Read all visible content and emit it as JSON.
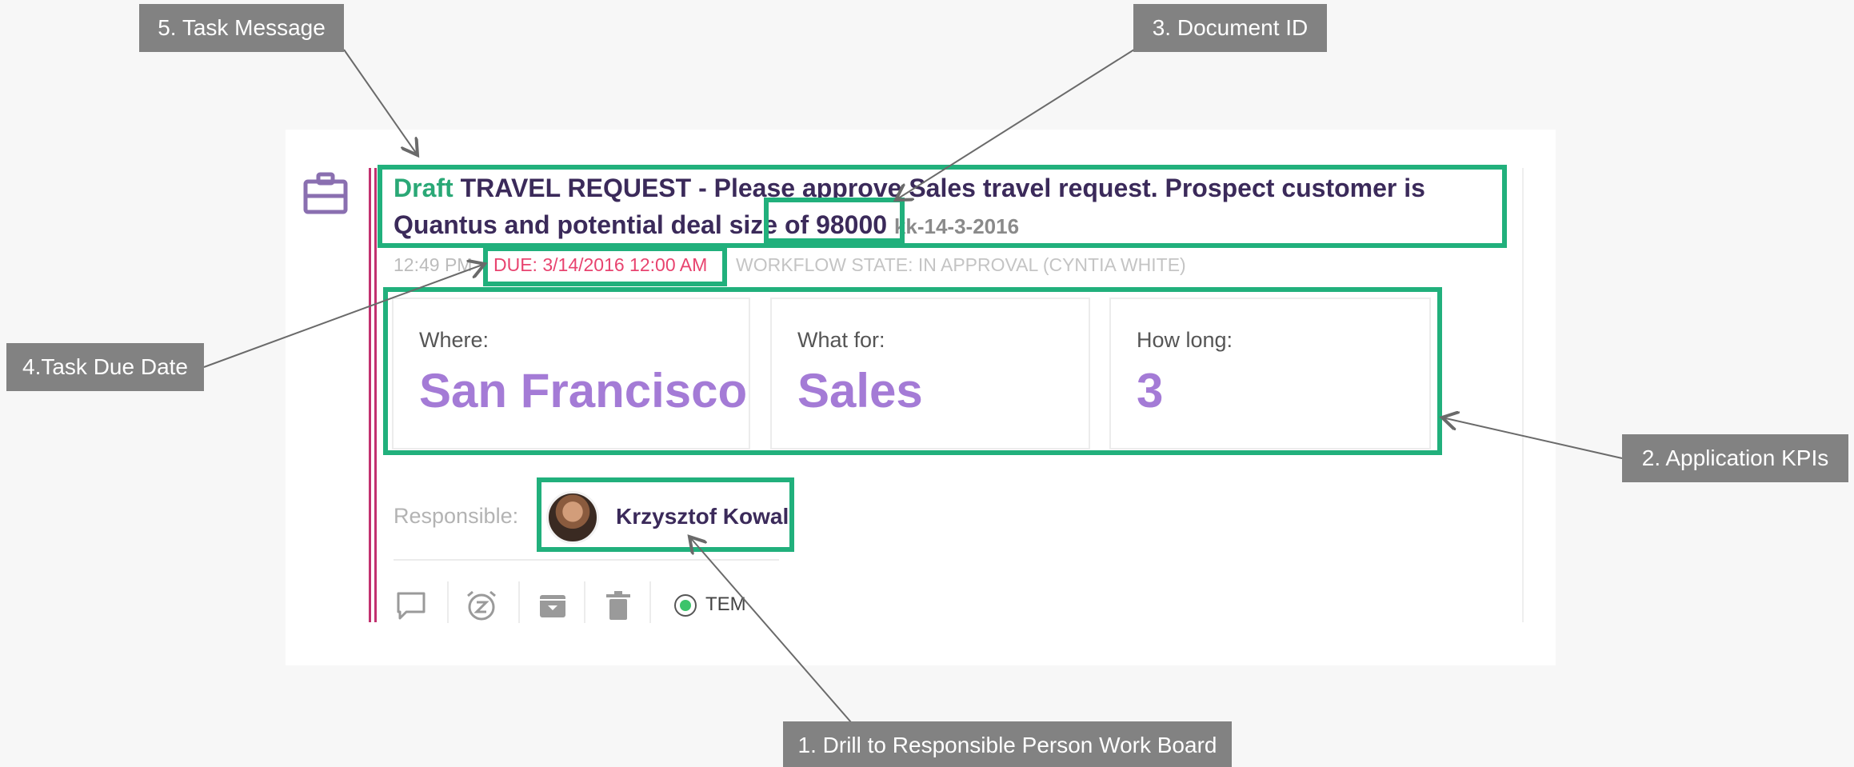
{
  "task": {
    "status": "Draft",
    "message": " TRAVEL REQUEST - Please approve Sales travel request. Prospect customer is Quantus and potential deal size of 98000 ",
    "document_id": "kk-14-3-2016",
    "time": "12:49 PM",
    "due": "DUE: 3/14/2016 12:00 AM",
    "workflow_state": "WORKFLOW STATE: IN APPROVAL (CYNTIA WHITE)"
  },
  "kpis": [
    {
      "label": "Where:",
      "value": "San Francisco"
    },
    {
      "label": "What for:",
      "value": "Sales"
    },
    {
      "label": "How long:",
      "value": "3"
    }
  ],
  "responsible": {
    "label": "Responsible:",
    "name": "Krzysztof Kowal"
  },
  "actions": {
    "items": [
      "comment-icon",
      "snooze-icon",
      "archive-icon",
      "delete-icon"
    ],
    "tem_label": "TEM"
  },
  "callouts": {
    "c1": "1. Drill to Responsible Person Work Board",
    "c2": "2.  Application KPIs",
    "c3": "3.  Document ID",
    "c4": "4.Task Due Date",
    "c5": "5. Task Message"
  },
  "colors": {
    "accent_green": "#21b07c",
    "draft_green": "#2aa876",
    "title_purple": "#3b2a5a",
    "kpi_purple": "#a47bd6",
    "due_red": "#e8436f",
    "bar_magenta": "#c2316f",
    "callout_gray": "#828282"
  }
}
